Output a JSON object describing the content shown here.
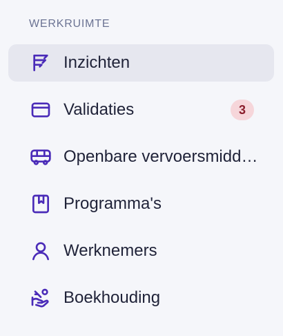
{
  "section": {
    "title": "WERKRUIMTE"
  },
  "nav": {
    "items": [
      {
        "label": "Inzichten",
        "icon": "chart-lines-icon",
        "active": true
      },
      {
        "label": "Validaties",
        "icon": "card-icon",
        "badge": "3"
      },
      {
        "label": "Openbare vervoersmiddelen",
        "icon": "bus-icon"
      },
      {
        "label": "Programma's",
        "icon": "bookmark-book-icon"
      },
      {
        "label": "Werknemers",
        "icon": "user-icon"
      },
      {
        "label": "Boekhouding",
        "icon": "hand-coins-icon"
      }
    ]
  },
  "colors": {
    "accent": "#4a2bb8",
    "active_bg": "#e6e7ef",
    "badge_bg": "#f6d6da",
    "badge_text": "#8b1f2d"
  }
}
